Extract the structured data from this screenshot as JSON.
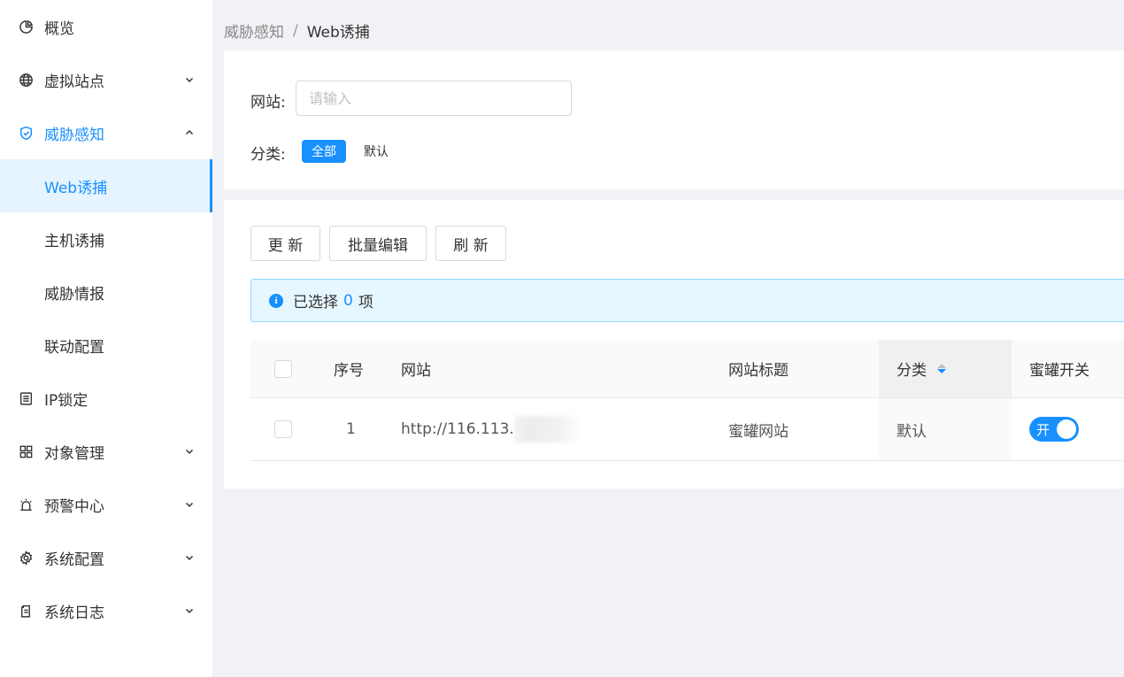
{
  "sidebar": {
    "items": [
      {
        "label": "概览",
        "icon": "pie-chart-icon"
      },
      {
        "label": "虚拟站点",
        "icon": "globe-icon"
      },
      {
        "label": "威胁感知",
        "icon": "shield-icon"
      },
      {
        "label": "Web诱捕"
      },
      {
        "label": "主机诱捕"
      },
      {
        "label": "威胁情报"
      },
      {
        "label": "联动配置"
      },
      {
        "label": "IP锁定",
        "icon": "list-icon"
      },
      {
        "label": "对象管理",
        "icon": "grid-icon"
      },
      {
        "label": "预警中心",
        "icon": "alarm-icon"
      },
      {
        "label": "系统配置",
        "icon": "gear-icon"
      },
      {
        "label": "系统日志",
        "icon": "log-icon"
      }
    ]
  },
  "breadcrumb": {
    "parent": "威胁感知",
    "separator": "/",
    "current": "Web诱捕"
  },
  "filter": {
    "site_label": "网站:",
    "site_placeholder": "请输入",
    "site_value": "",
    "category_label": "分类:",
    "category_all": "全部",
    "category_default": "默认"
  },
  "toolbar": {
    "update": "更 新",
    "batch_edit": "批量编辑",
    "refresh": "刷 新"
  },
  "alert": {
    "prefix": "已选择",
    "count": "0",
    "suffix": "项"
  },
  "table": {
    "headers": {
      "index": "序号",
      "site": "网站",
      "title": "网站标题",
      "category": "分类",
      "honeypot": "蜜罐开关"
    },
    "rows": [
      {
        "index": "1",
        "site": "http://116.113.",
        "title": "蜜罐网站",
        "category": "默认",
        "switch": "开"
      }
    ]
  },
  "colors": {
    "accent": "#1890ff",
    "active_bg": "#e6f4ff",
    "page_bg": "#f0f2f5"
  }
}
